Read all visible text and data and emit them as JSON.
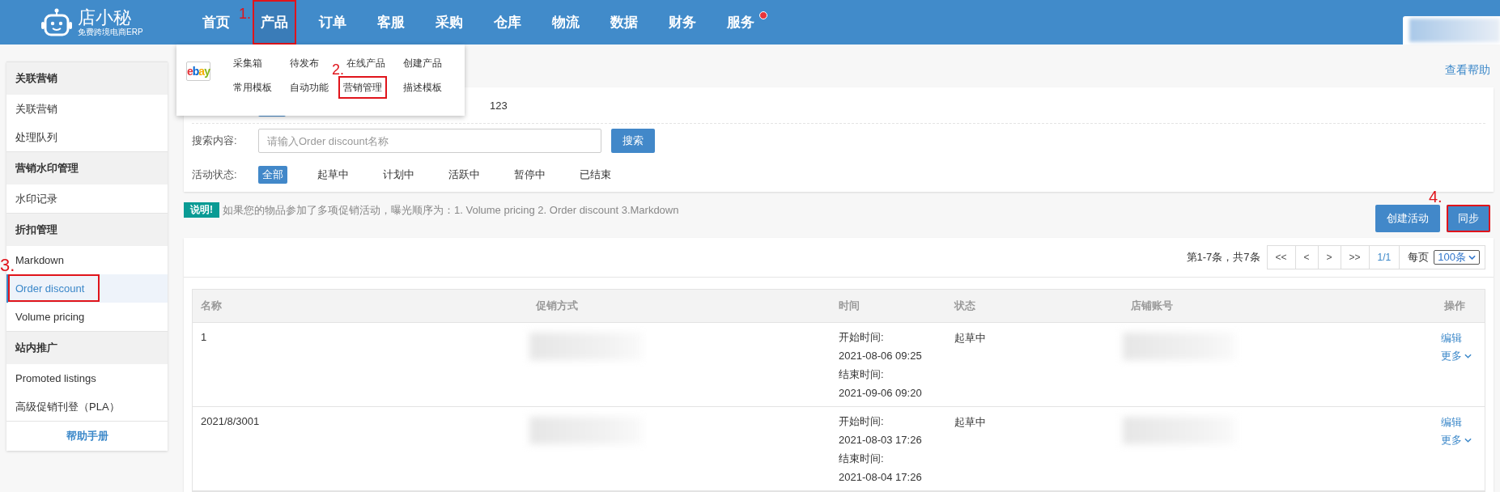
{
  "header": {
    "logo": {
      "name": "店小秘",
      "tagline": "免费跨境电商ERP"
    },
    "nav": [
      {
        "label": "首页",
        "selected": false
      },
      {
        "label": "产品",
        "selected": true,
        "annotation": "1."
      },
      {
        "label": "订单",
        "selected": false
      },
      {
        "label": "客服",
        "selected": false
      },
      {
        "label": "采购",
        "selected": false
      },
      {
        "label": "仓库",
        "selected": false
      },
      {
        "label": "物流",
        "selected": false
      },
      {
        "label": "数据",
        "selected": false
      },
      {
        "label": "财务",
        "selected": false
      },
      {
        "label": "服务",
        "selected": false,
        "badge": true
      }
    ],
    "user": {
      "redacted": true
    }
  },
  "sidebar": {
    "groups": [
      {
        "title": "关联营销",
        "items": [
          {
            "label": "关联营销",
            "selected": false
          },
          {
            "label": "处理队列",
            "selected": false
          }
        ]
      },
      {
        "title": "营销水印管理",
        "items": [
          {
            "label": "水印记录",
            "selected": false
          }
        ]
      },
      {
        "title": "折扣管理",
        "items": [
          {
            "label": "Markdown",
            "selected": false
          },
          {
            "label": "Order discount",
            "selected": true,
            "annotation": "3."
          },
          {
            "label": "Volume pricing",
            "selected": false
          }
        ]
      },
      {
        "title": "站内推广",
        "items": [
          {
            "label": "Promoted listings",
            "selected": false
          },
          {
            "label": "高级促销刊登（PLA）",
            "selected": false
          }
        ]
      }
    ],
    "footer": "帮助手册"
  },
  "dropdown": {
    "platform": "ebay",
    "links": [
      {
        "label": "采集箱"
      },
      {
        "label": "待发布"
      },
      {
        "label": "在线产品"
      },
      {
        "label": "创建产品"
      },
      {
        "label": "常用模板"
      },
      {
        "label": "自动功能"
      },
      {
        "label": "营销管理",
        "annotation": "2."
      },
      {
        "label": "描述模板"
      }
    ]
  },
  "help_link": "查看帮助",
  "filters": {
    "account_text": "123",
    "search": {
      "label": "搜索内容:",
      "placeholder": "请输入Order discount名称",
      "button": "搜索"
    },
    "status": {
      "label": "活动状态:",
      "options": [
        {
          "label": "全部",
          "selected": true
        },
        {
          "label": "起草中",
          "selected": false
        },
        {
          "label": "计划中",
          "selected": false
        },
        {
          "label": "活跃中",
          "selected": false
        },
        {
          "label": "暂停中",
          "selected": false
        },
        {
          "label": "已结束",
          "selected": false
        }
      ]
    }
  },
  "notice": {
    "badge": "说明!",
    "text": "如果您的物品参加了多项促销活动，曝光顺序为：1. Volume pricing 2. Order discount 3.Markdown"
  },
  "actions": [
    {
      "label": "创建活动"
    },
    {
      "label": "同步",
      "annotation": "4."
    }
  ],
  "pagination": {
    "summary": "第1-7条，共7条",
    "buttons": [
      "<<",
      "<",
      ">",
      ">>"
    ],
    "page": "1/1",
    "per_page_label": "每页",
    "per_page": "100条"
  },
  "table": {
    "columns": [
      "名称",
      "促销方式",
      "时间",
      "状态",
      "店铺账号",
      "操作"
    ],
    "rows": [
      {
        "name": "1",
        "method_redacted": true,
        "start_label": "开始时间:",
        "start": "2021-08-06 09:25",
        "end_label": "结束时间:",
        "end": "2021-09-06 09:20",
        "status": "起草中",
        "account_redacted": true,
        "edit": "编辑",
        "more": "更多"
      },
      {
        "name": "2021/8/3001",
        "method_redacted": true,
        "start_label": "开始时间:",
        "start": "2021-08-03 17:26",
        "end_label": "结束时间:",
        "end": "2021-08-04 17:26",
        "status": "起草中",
        "account_redacted": true,
        "edit": "编辑",
        "more": "更多"
      }
    ]
  }
}
